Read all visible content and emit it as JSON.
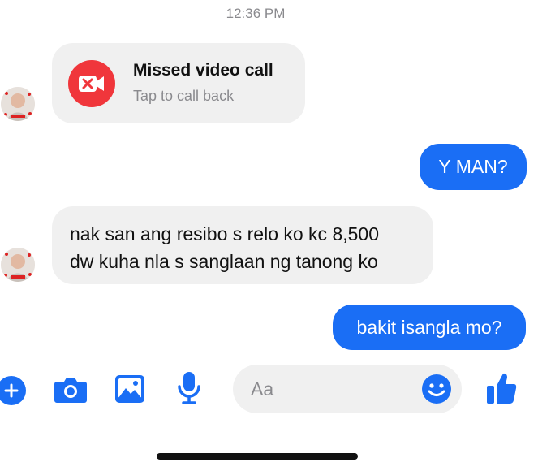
{
  "thread": {
    "timestamp": "12:36 PM",
    "missed_call": {
      "title": "Missed video call",
      "subtitle": "Tap to call back",
      "icon": "video-camera-off-icon"
    },
    "messages_out": [
      {
        "text": "Y MAN?"
      },
      {
        "text": "bakit isangla mo?"
      }
    ],
    "message_in": {
      "lines": [
        "nak san ang resibo s relo ko kc 8,500",
        "dw kuha nla s sanglaan ng tanong ko"
      ]
    }
  },
  "composer": {
    "placeholder": "Aa",
    "icons": [
      "plus-icon",
      "camera-icon",
      "image-icon",
      "microphone-icon",
      "emoji-icon",
      "thumbs-up-icon"
    ]
  },
  "colors": {
    "accent": "#1a6ef5",
    "missed_call": "#f0363b",
    "incoming_bubble": "#f0f0f0",
    "timestamp": "#8a8a8e"
  }
}
